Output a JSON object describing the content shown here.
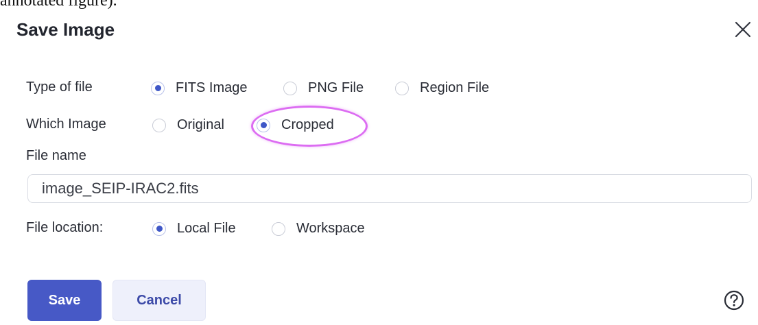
{
  "caption": "annotated figure).",
  "dialog": {
    "title": "Save Image",
    "close_icon": "close-icon",
    "type_of_file": {
      "label": "Type of file",
      "options": [
        "FITS Image",
        "PNG File",
        "Region File"
      ],
      "selected": "FITS Image"
    },
    "which_image": {
      "label": "Which Image",
      "options": [
        "Original",
        "Cropped"
      ],
      "selected": "Cropped"
    },
    "file_name": {
      "label": "File name",
      "value": "image_SEIP-IRAC2.fits"
    },
    "file_location": {
      "label": "File location:",
      "options": [
        "Local File",
        "Workspace"
      ],
      "selected": "Local File"
    },
    "buttons": {
      "save": "Save",
      "cancel": "Cancel"
    },
    "help_icon": "help-icon"
  },
  "colors": {
    "accent": "#4759c6",
    "radio_selected": "#3f57c7",
    "annotation": "#dc6cf2",
    "cancel_bg": "#eef0fb"
  }
}
